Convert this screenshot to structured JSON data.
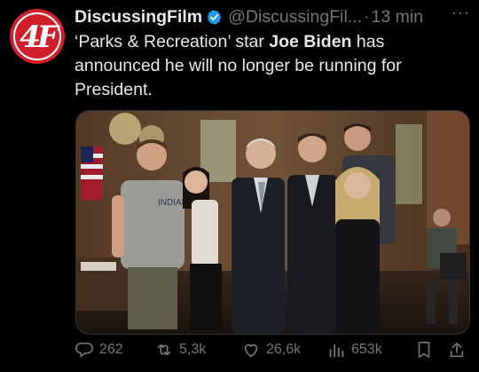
{
  "tweet": {
    "display_name": "DiscussingFilm",
    "handle": "@DiscussingFil...",
    "separator": "·",
    "time": "13 min",
    "more_label": "···",
    "text_before": "‘Parks & Recreation’ star ",
    "text_bold": "Joe Biden",
    "text_after": " has announced he will no longer be running for President.",
    "photo_sign_text": "INDIANA"
  },
  "avatar": {
    "mark": "4F",
    "color": "#d01f2b"
  },
  "actions": {
    "replies": "262",
    "reposts": "5,3k",
    "likes": "26,6k",
    "views": "653k"
  },
  "colors": {
    "accent": "#1d9bf0",
    "muted": "#71767b",
    "text": "#e7e9ea",
    "background": "#000000"
  }
}
